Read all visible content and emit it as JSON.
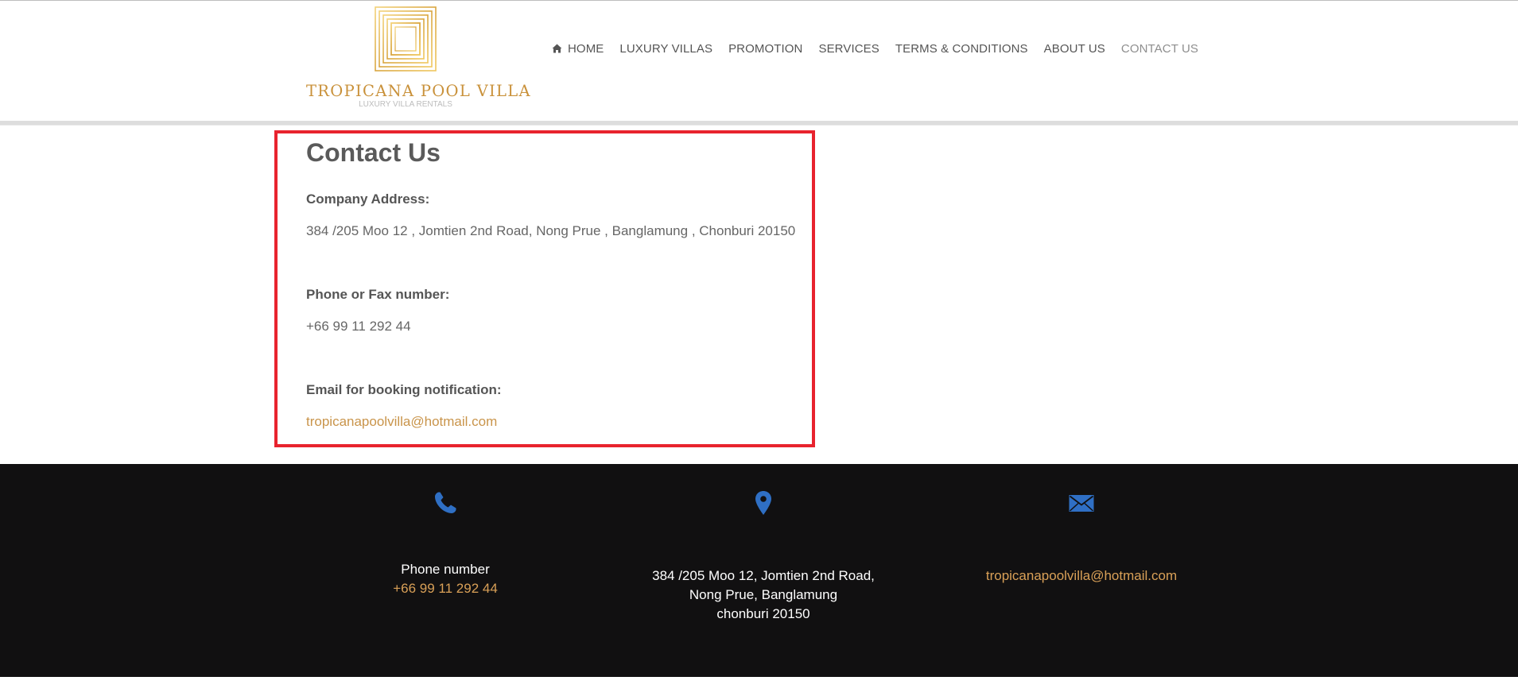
{
  "brand": {
    "name": "TROPICANA POOL VILLA",
    "tagline": "LUXURY VILLA RENTALS",
    "gold": "#c9913a"
  },
  "nav": {
    "items": [
      {
        "label": "HOME",
        "icon": "home-icon"
      },
      {
        "label": "LUXURY VILLAS"
      },
      {
        "label": "PROMOTION"
      },
      {
        "label": "SERVICES"
      },
      {
        "label": "TERMS & CONDITIONS"
      },
      {
        "label": "ABOUT US"
      },
      {
        "label": "CONTACT US",
        "active": true
      }
    ]
  },
  "contact": {
    "title": "Contact Us",
    "address_label": "Company Address:",
    "address_value": "384 /205 Moo 12 , Jomtien 2nd Road, Nong Prue , Banglamung , Chonburi 20150",
    "phone_label": "Phone or Fax number:",
    "phone_value": "+66 99 11 292 44",
    "email_label": "Email for booking notification:",
    "email_value": "tropicanapoolvilla@hotmail.com",
    "highlight_color": "#e8232e"
  },
  "footer": {
    "phone": {
      "icon": "phone-icon",
      "heading": "Phone number",
      "value": "+66 99 11 292 44"
    },
    "address": {
      "icon": "location-pin-icon",
      "line1": "384 /205 Moo 12, Jomtien 2nd Road,",
      "line2": "Nong Prue, Banglamung",
      "line3": "chonburi 20150"
    },
    "email": {
      "icon": "envelope-icon",
      "value": "tropicanapoolvilla@hotmail.com"
    },
    "icon_color": "#2f6fc4",
    "link_color": "#d9a057",
    "background": "#111011"
  }
}
